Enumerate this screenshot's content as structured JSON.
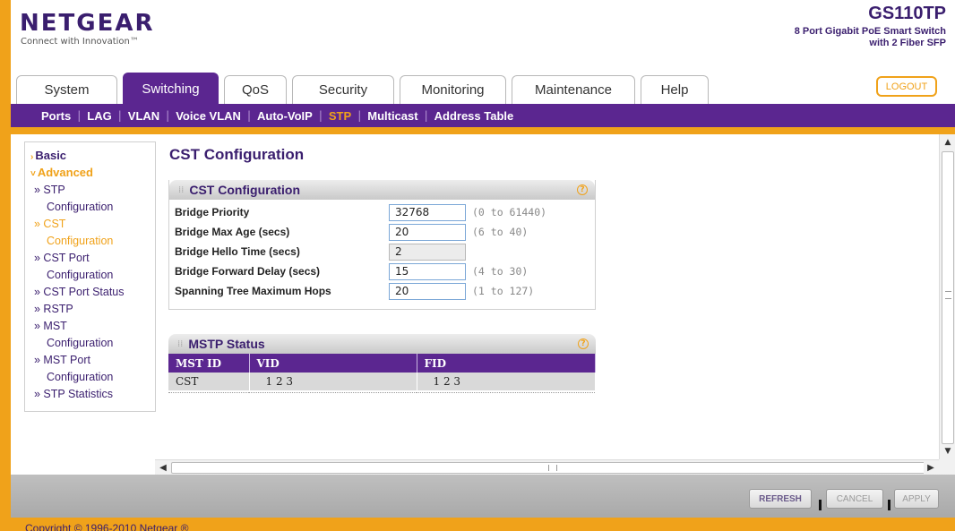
{
  "brand": {
    "logo": "NETGEAR",
    "tagline": "Connect with Innovation™"
  },
  "device": {
    "model": "GS110TP",
    "description_line1": "8 Port Gigabit PoE Smart Switch",
    "description_line2": "with 2 Fiber SFP"
  },
  "main_tabs": [
    {
      "label": "System"
    },
    {
      "label": "Switching"
    },
    {
      "label": "QoS"
    },
    {
      "label": "Security"
    },
    {
      "label": "Monitoring"
    },
    {
      "label": "Maintenance"
    },
    {
      "label": "Help"
    }
  ],
  "active_tab": "Switching",
  "logout_label": "LOGOUT",
  "sub_nav": [
    {
      "label": "Ports"
    },
    {
      "label": "LAG"
    },
    {
      "label": "VLAN"
    },
    {
      "label": "Voice VLAN"
    },
    {
      "label": "Auto-VoIP"
    },
    {
      "label": "STP"
    },
    {
      "label": "Multicast"
    },
    {
      "label": "Address Table"
    }
  ],
  "active_sub_nav": "STP",
  "left_nav": {
    "basic": "Basic",
    "advanced": "Advanced",
    "items": [
      {
        "line1": "» STP",
        "line2": "Configuration"
      },
      {
        "line1": "» CST",
        "line2": "Configuration"
      },
      {
        "line1": "» CST Port",
        "line2": "Configuration"
      },
      {
        "line1": "» CST Port Status",
        "line2": ""
      },
      {
        "line1": "» RSTP",
        "line2": ""
      },
      {
        "line1": "» MST",
        "line2": "Configuration"
      },
      {
        "line1": "» MST Port",
        "line2": "Configuration"
      },
      {
        "line1": "» STP Statistics",
        "line2": ""
      }
    ],
    "active_item": "» CST"
  },
  "page_title": "CST Configuration",
  "cst_panel": {
    "title": "CST Configuration",
    "help": "?",
    "rows": [
      {
        "label": "Bridge Priority",
        "value": "32768",
        "range": "(0 to 61440)",
        "readonly": false
      },
      {
        "label": "Bridge Max Age (secs)",
        "value": "20",
        "range": "(6 to 40)",
        "readonly": false
      },
      {
        "label": "Bridge Hello Time (secs)",
        "value": "2",
        "range": "",
        "readonly": true
      },
      {
        "label": "Bridge Forward Delay (secs)",
        "value": "15",
        "range": "(4 to 30)",
        "readonly": false
      },
      {
        "label": "Spanning Tree Maximum Hops",
        "value": "20",
        "range": "(1 to 127)",
        "readonly": false
      }
    ]
  },
  "mstp_panel": {
    "title": "MSTP Status",
    "help": "?",
    "columns": [
      "MST ID",
      "VID",
      "FID"
    ],
    "rows": [
      [
        "CST",
        "1 2 3",
        "1 2 3"
      ]
    ]
  },
  "footer": {
    "refresh": "REFRESH",
    "cancel": "CANCEL",
    "apply": "APPLY",
    "copyright": "Copyright © 1996-2010 Netgear ®"
  },
  "colors": {
    "purple": "#5b2690",
    "orange": "#f0a21a",
    "navy_text": "#3a1e6e"
  }
}
